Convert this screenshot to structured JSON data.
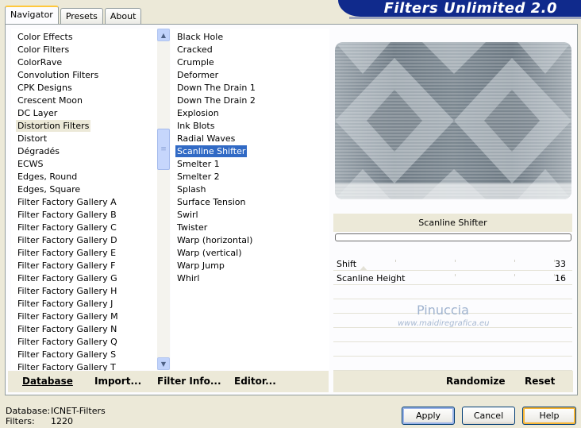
{
  "header": {
    "title": "Filters Unlimited 2.0"
  },
  "tabs": [
    {
      "label": "Navigator",
      "active": true
    },
    {
      "label": "Presets",
      "active": false
    },
    {
      "label": "About",
      "active": false
    }
  ],
  "categories": {
    "items": [
      "Color Effects",
      "Color Filters",
      "ColorRave",
      "Convolution Filters",
      "CPK Designs",
      "Crescent Moon",
      "DC Layer",
      "Distortion Filters",
      "Distort",
      "Dégradés",
      "ECWS",
      "Edges, Round",
      "Edges, Square",
      "Filter Factory Gallery A",
      "Filter Factory Gallery B",
      "Filter Factory Gallery C",
      "Filter Factory Gallery D",
      "Filter Factory Gallery E",
      "Filter Factory Gallery F",
      "Filter Factory Gallery G",
      "Filter Factory Gallery H",
      "Filter Factory Gallery J",
      "Filter Factory Gallery M",
      "Filter Factory Gallery N",
      "Filter Factory Gallery Q",
      "Filter Factory Gallery S",
      "Filter Factory Gallery T"
    ],
    "selected": "Distortion Filters"
  },
  "filters": {
    "items": [
      "Black Hole",
      "Cracked",
      "Crumple",
      "Deformer",
      "Down The Drain 1",
      "Down The Drain 2",
      "Explosion",
      "Ink Blots",
      "Radial Waves",
      "Scanline Shifter",
      "Smelter 1",
      "Smelter 2",
      "Splash",
      "Surface Tension",
      "Swirl",
      "Twister",
      "Warp (horizontal)",
      "Warp (vertical)",
      "Warp Jump",
      "Whirl"
    ],
    "selected": "Scanline Shifter"
  },
  "effect": {
    "name": "Scanline Shifter",
    "params": [
      {
        "label": "Shift",
        "value": "33"
      },
      {
        "label": "Scanline Height",
        "value": "16"
      }
    ]
  },
  "watermark": {
    "name": "Pinuccia",
    "url": "www.maidiregrafica.eu"
  },
  "toolbar": {
    "database": "Database",
    "import": "Import...",
    "filter_info": "Filter Info...",
    "editor": "Editor...",
    "randomize": "Randomize",
    "reset": "Reset"
  },
  "footer": {
    "database_label": "Database:",
    "database_value": "ICNET-Filters",
    "filters_label": "Filters:",
    "filters_value": "1220"
  },
  "buttons": {
    "apply": "Apply",
    "cancel": "Cancel",
    "help": "Help"
  },
  "colors": {
    "banner": "#102A8C",
    "selection": "#316AC5",
    "face": "#ECE9D8"
  },
  "icons": {
    "scroll_up": "chevron-up-icon",
    "scroll_down": "chevron-down-icon"
  }
}
